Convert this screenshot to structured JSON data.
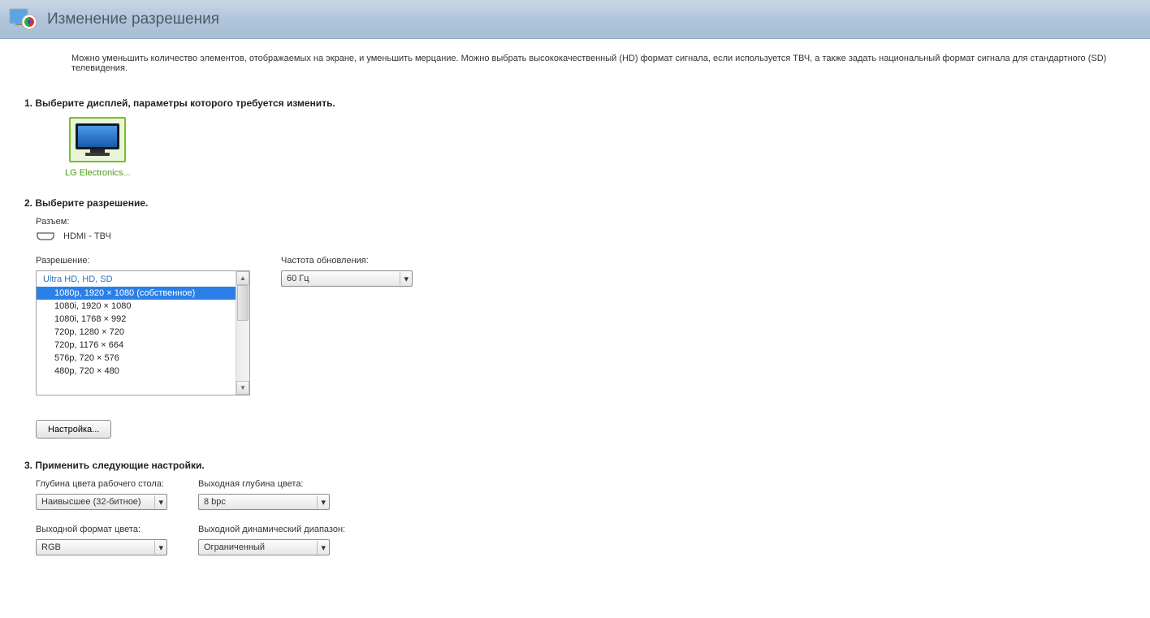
{
  "header": {
    "title": "Изменение разрешения"
  },
  "description": "Можно уменьшить количество элементов, отображаемых на экране, и уменьшить мерцание. Можно выбрать высококачественный (HD) формат сигнала, если используется ТВЧ, а также задать национальный формат сигнала для стандартного (SD) телевидения.",
  "section1": {
    "title": "1. Выберите дисплей, параметры которого требуется изменить.",
    "display_label": "LG Electronics..."
  },
  "section2": {
    "title": "2. Выберите разрешение.",
    "connector_label": "Разъем:",
    "connector_value": "HDMI - ТВЧ",
    "resolution_label": "Разрешение:",
    "refresh_label": "Частота обновления:",
    "refresh_value": "60 Гц",
    "list_header": "Ultra HD, HD, SD",
    "items": [
      "1080p, 1920 × 1080 (собственное)",
      "1080i, 1920 × 1080",
      "1080i, 1768 × 992",
      "720p, 1280 × 720",
      "720p, 1176 × 664",
      "576p, 720 × 576",
      "480p, 720 × 480"
    ],
    "customize_btn": "Настройка..."
  },
  "section3": {
    "title": "3. Применить следующие настройки.",
    "color_depth_label": "Глубина цвета рабочего стола:",
    "color_depth_value": "Наивысшее (32-битное)",
    "output_depth_label": "Выходная глубина цвета:",
    "output_depth_value": "8 bpc",
    "color_format_label": "Выходной формат цвета:",
    "color_format_value": "RGB",
    "dynamic_range_label": "Выходной динамический диапазон:",
    "dynamic_range_value": "Ограниченный"
  }
}
